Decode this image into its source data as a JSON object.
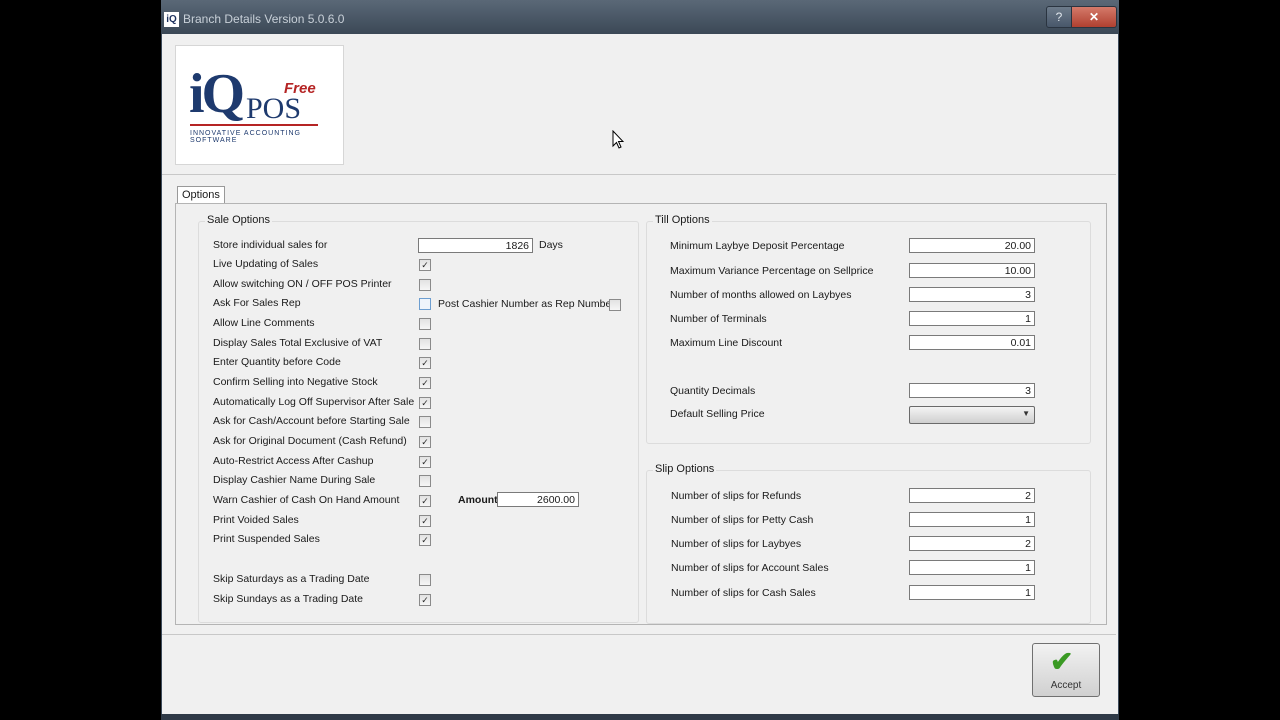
{
  "window": {
    "title": "Branch Details Version 5.0.6.0",
    "app_icon": "iQ",
    "help_label": "?",
    "close_label": "✕"
  },
  "logo": {
    "brand": "iQ",
    "free": "Free",
    "pos": "POS",
    "tagline": "INNOVATIVE ACCOUNTING SOFTWARE"
  },
  "tab": {
    "label": "Options"
  },
  "sale_options": {
    "title": "Sale Options",
    "store_sales": {
      "label": "Store individual sales for",
      "value": "1826",
      "unit": "Days"
    },
    "items": [
      {
        "label": "Live Updating of Sales",
        "checked": true
      },
      {
        "label": "Allow switching ON / OFF POS Printer",
        "checked": false
      },
      {
        "label": "Ask For Sales Rep",
        "checked": false
      },
      {
        "label": "Allow Line Comments",
        "checked": false
      },
      {
        "label": "Display Sales Total Exclusive of VAT",
        "checked": false
      },
      {
        "label": "Enter Quantity before Code",
        "checked": true
      },
      {
        "label": "Confirm Selling into Negative Stock",
        "checked": true
      },
      {
        "label": "Automatically Log Off Supervisor After Sale",
        "checked": true
      },
      {
        "label": "Ask for Cash/Account before Starting Sale",
        "checked": false
      },
      {
        "label": "Ask for Original Document (Cash Refund)",
        "checked": true
      },
      {
        "label": "Auto-Restrict Access After Cashup",
        "checked": true
      },
      {
        "label": "Display Cashier Name During Sale",
        "checked": false
      },
      {
        "label": "Warn Cashier of Cash On Hand Amount",
        "checked": true
      },
      {
        "label": "Print Voided Sales",
        "checked": true
      },
      {
        "label": "Print Suspended Sales",
        "checked": true
      },
      {
        "label": "Skip Saturdays as a Trading Date",
        "checked": false
      },
      {
        "label": "Skip Sundays as a Trading Date",
        "checked": true
      }
    ],
    "post_cashier": {
      "label": "Post Cashier Number as Rep Number",
      "checked": false
    },
    "amount": {
      "label": "Amount",
      "value": "2600.00"
    }
  },
  "till_options": {
    "title": "Till Options",
    "fields": [
      {
        "label": "Minimum Laybye Deposit Percentage",
        "value": "20.00"
      },
      {
        "label": "Maximum Variance Percentage on Sellprice",
        "value": "10.00"
      },
      {
        "label": "Number of months allowed on Laybyes",
        "value": "3"
      },
      {
        "label": "Number of Terminals",
        "value": "1"
      },
      {
        "label": "Maximum Line Discount",
        "value": "0.01"
      },
      {
        "label": "Quantity Decimals",
        "value": "3"
      }
    ],
    "default_price": {
      "label": "Default Selling Price",
      "value": ""
    }
  },
  "slip_options": {
    "title": "Slip Options",
    "fields": [
      {
        "label": "Number of slips for Refunds",
        "value": "2"
      },
      {
        "label": "Number of slips for Petty Cash",
        "value": "1"
      },
      {
        "label": "Number of slips for Laybyes",
        "value": "2"
      },
      {
        "label": "Number of slips for Account Sales",
        "value": "1"
      },
      {
        "label": "Number of slips for Cash Sales",
        "value": "1"
      }
    ]
  },
  "accept_button": {
    "label": "Accept"
  },
  "colors": {
    "accent": "#1e3a6e",
    "brand_red": "#b52424",
    "check_green": "#3a9a24"
  }
}
